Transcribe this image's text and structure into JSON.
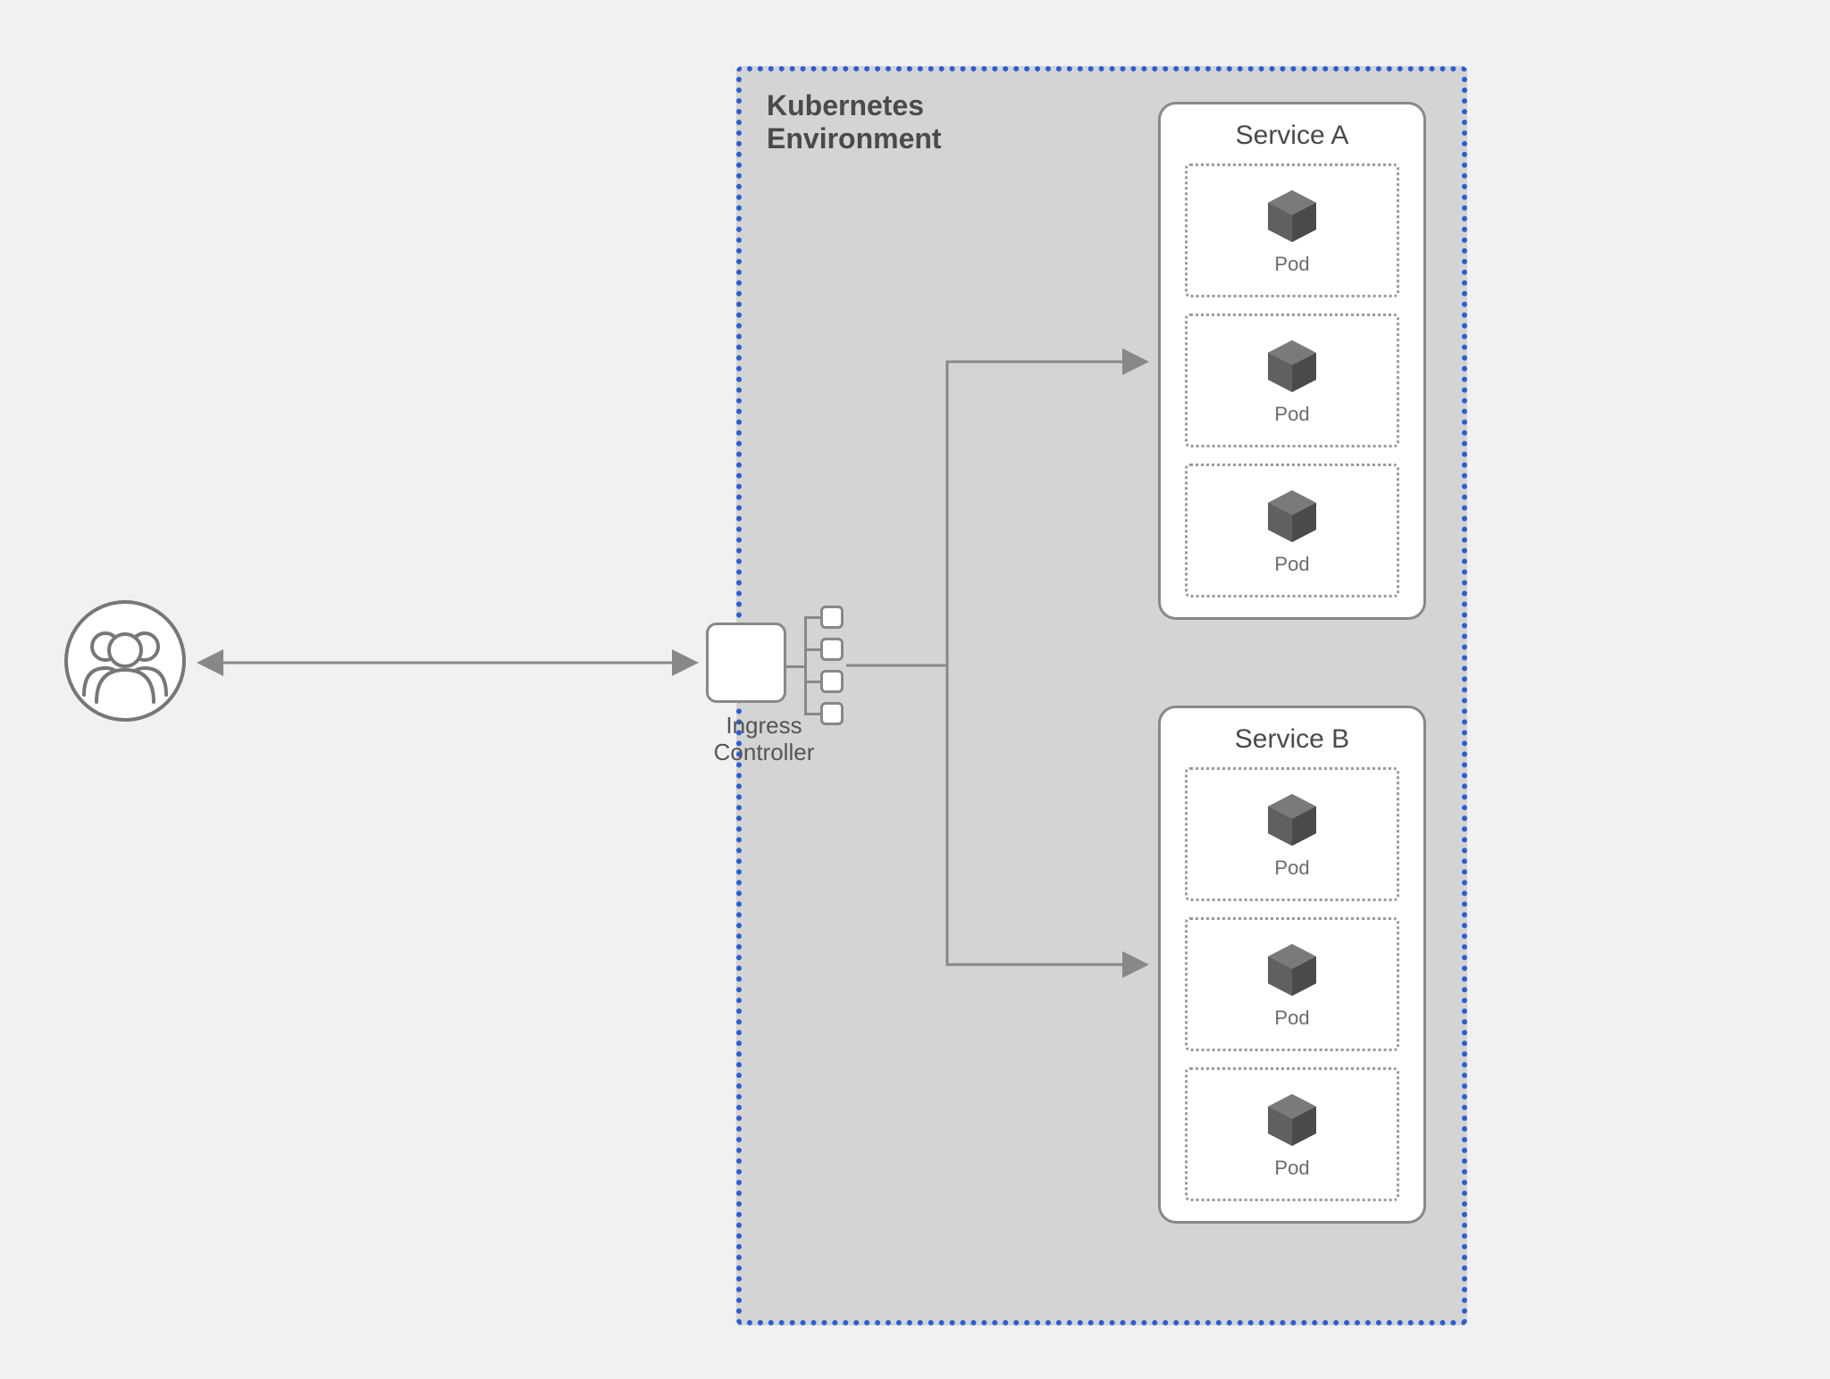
{
  "environment": {
    "title": "Kubernetes\nEnvironment"
  },
  "ingress": {
    "label": "Ingress\nController"
  },
  "services": {
    "a": {
      "title": "Service A",
      "pods": [
        "Pod",
        "Pod",
        "Pod"
      ]
    },
    "b": {
      "title": "Service B",
      "pods": [
        "Pod",
        "Pod",
        "Pod"
      ]
    }
  },
  "nodes": {
    "users": {
      "name": "users"
    }
  },
  "colors": {
    "dotBorder": "#2a5ed8",
    "stroke": "#888888",
    "cube": "#555555",
    "bg": "#f1f1f1",
    "envBg": "#d4d4d4"
  }
}
